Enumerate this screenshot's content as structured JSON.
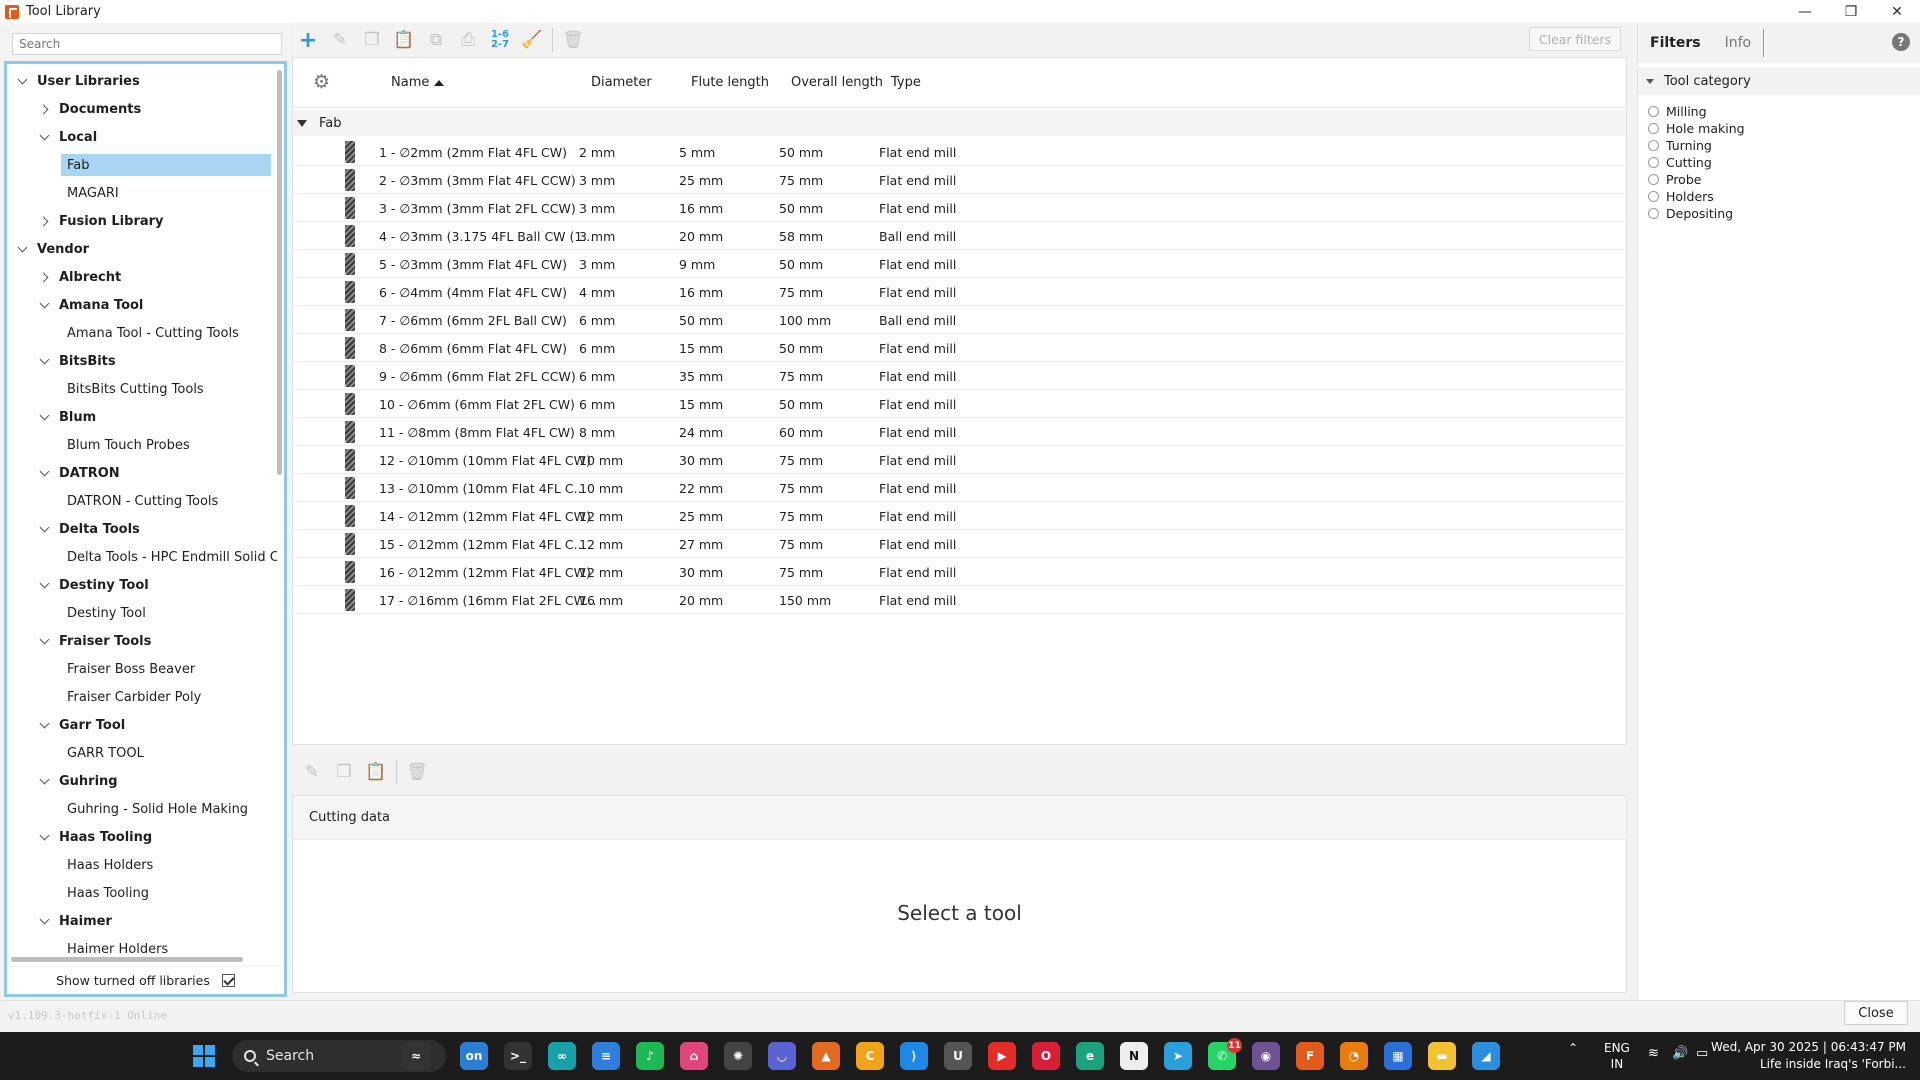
{
  "window": {
    "title": "Tool Library"
  },
  "left": {
    "search_placeholder": "Search",
    "show_turned_off_label": "Show turned off libraries",
    "show_turned_off_checked": true,
    "tree": [
      {
        "label": "User Libraries",
        "level": 0,
        "expand": "down",
        "bold": true
      },
      {
        "label": "Documents",
        "level": 1,
        "expand": "right",
        "bold": true
      },
      {
        "label": "Local",
        "level": 1,
        "expand": "down",
        "bold": true
      },
      {
        "label": "Fab",
        "level": 2,
        "expand": "none",
        "bold": false,
        "selected": true
      },
      {
        "label": "MAGARI",
        "level": 2,
        "expand": "none",
        "bold": false
      },
      {
        "label": "Fusion Library",
        "level": 1,
        "expand": "right",
        "bold": true
      },
      {
        "label": "Vendor",
        "level": 0,
        "expand": "down",
        "bold": true
      },
      {
        "label": "Albrecht",
        "level": 1,
        "expand": "right",
        "bold": true
      },
      {
        "label": "Amana Tool",
        "level": 1,
        "expand": "down",
        "bold": true
      },
      {
        "label": "Amana Tool - Cutting Tools",
        "level": 2,
        "expand": "none",
        "bold": false
      },
      {
        "label": "BitsBits",
        "level": 1,
        "expand": "down",
        "bold": true
      },
      {
        "label": "BitsBits Cutting Tools",
        "level": 2,
        "expand": "none",
        "bold": false
      },
      {
        "label": "Blum",
        "level": 1,
        "expand": "down",
        "bold": true
      },
      {
        "label": "Blum Touch Probes",
        "level": 2,
        "expand": "none",
        "bold": false
      },
      {
        "label": "DATRON",
        "level": 1,
        "expand": "down",
        "bold": true
      },
      {
        "label": "DATRON - Cutting Tools",
        "level": 2,
        "expand": "none",
        "bold": false
      },
      {
        "label": "Delta Tools",
        "level": 1,
        "expand": "down",
        "bold": true
      },
      {
        "label": "Delta Tools - HPC Endmill Solid Carb",
        "level": 2,
        "expand": "none",
        "bold": false
      },
      {
        "label": "Destiny Tool",
        "level": 1,
        "expand": "down",
        "bold": true
      },
      {
        "label": "Destiny Tool",
        "level": 2,
        "expand": "none",
        "bold": false
      },
      {
        "label": "Fraiser Tools",
        "level": 1,
        "expand": "down",
        "bold": true
      },
      {
        "label": "Fraiser Boss Beaver",
        "level": 2,
        "expand": "none",
        "bold": false
      },
      {
        "label": "Fraiser Carbider Poly",
        "level": 2,
        "expand": "none",
        "bold": false
      },
      {
        "label": "Garr Tool",
        "level": 1,
        "expand": "down",
        "bold": true
      },
      {
        "label": "GARR TOOL",
        "level": 2,
        "expand": "none",
        "bold": false
      },
      {
        "label": "Guhring",
        "level": 1,
        "expand": "down",
        "bold": true
      },
      {
        "label": "Guhring - Solid Hole Making",
        "level": 2,
        "expand": "none",
        "bold": false
      },
      {
        "label": "Haas Tooling",
        "level": 1,
        "expand": "down",
        "bold": true
      },
      {
        "label": "Haas Holders",
        "level": 2,
        "expand": "none",
        "bold": false
      },
      {
        "label": "Haas Tooling",
        "level": 2,
        "expand": "none",
        "bold": false
      },
      {
        "label": "Haimer",
        "level": 1,
        "expand": "down",
        "bold": true
      },
      {
        "label": "Haimer Holders",
        "level": 2,
        "expand": "none",
        "bold": false
      }
    ]
  },
  "toolbar": {
    "clear_filters": "Clear filters",
    "renumber_label": "1-6 2-7"
  },
  "table": {
    "columns": [
      "Name",
      "Diameter",
      "Flute length",
      "Overall length",
      "Type"
    ],
    "group": "Fab",
    "rows": [
      [
        "1 - ∅2mm (2mm Flat 4FL CW)",
        "2 mm",
        "5 mm",
        "50 mm",
        "Flat end mill"
      ],
      [
        "2 - ∅3mm (3mm Flat 4FL CCW)",
        "3 mm",
        "25 mm",
        "75 mm",
        "Flat end mill"
      ],
      [
        "3 - ∅3mm (3mm Flat 2FL CCW)",
        "3 mm",
        "16 mm",
        "50 mm",
        "Flat end mill"
      ],
      [
        "4 - ∅3mm (3.175 4FL Ball CW (1...",
        "3 mm",
        "20 mm",
        "58 mm",
        "Ball end mill"
      ],
      [
        "5 - ∅3mm (3mm Flat 4FL CW)",
        "3 mm",
        "9 mm",
        "50 mm",
        "Flat end mill"
      ],
      [
        "6 - ∅4mm (4mm Flat 4FL CW)",
        "4 mm",
        "16 mm",
        "75 mm",
        "Flat end mill"
      ],
      [
        "7 - ∅6mm (6mm 2FL Ball CW)",
        "6 mm",
        "50 mm",
        "100 mm",
        "Ball end mill"
      ],
      [
        "8 - ∅6mm (6mm Flat 4FL CW)",
        "6 mm",
        "15 mm",
        "50 mm",
        "Flat end mill"
      ],
      [
        "9 - ∅6mm (6mm Flat 2FL CCW)",
        "6 mm",
        "35 mm",
        "75 mm",
        "Flat end mill"
      ],
      [
        "10 - ∅6mm (6mm Flat 2FL CW)",
        "6 mm",
        "15 mm",
        "50 mm",
        "Flat end mill"
      ],
      [
        "11 - ∅8mm (8mm Flat 4FL CW)",
        "8 mm",
        "24 mm",
        "60 mm",
        "Flat end mill"
      ],
      [
        "12 - ∅10mm (10mm Flat 4FL CW)",
        "10 mm",
        "30 mm",
        "75 mm",
        "Flat end mill"
      ],
      [
        "13 - ∅10mm (10mm Flat 4FL C...",
        "10 mm",
        "22 mm",
        "75 mm",
        "Flat end mill"
      ],
      [
        "14 - ∅12mm (12mm Flat 4FL CW)",
        "12 mm",
        "25 mm",
        "75 mm",
        "Flat end mill"
      ],
      [
        "15 - ∅12mm (12mm Flat 4FL C...",
        "12 mm",
        "27 mm",
        "75 mm",
        "Flat end mill"
      ],
      [
        "16 - ∅12mm (12mm Flat 4FL CW)",
        "12 mm",
        "30 mm",
        "75 mm",
        "Flat end mill"
      ],
      [
        "17 - ∅16mm (16mm Flat 2FL CW...",
        "16 mm",
        "20 mm",
        "150 mm",
        "Flat end mill"
      ]
    ]
  },
  "bottom": {
    "tab_label": "Cutting data",
    "empty_message": "Select a tool"
  },
  "right": {
    "tabs": [
      "Filters",
      "Info"
    ],
    "category_header": "Tool category",
    "categories": [
      "Milling",
      "Hole making",
      "Turning",
      "Cutting",
      "Probe",
      "Holders",
      "Depositing"
    ]
  },
  "status": {
    "version": "v1.109.3-hotfix-1 Online",
    "close_label": "Close"
  },
  "taskbar": {
    "search_label": "Search",
    "lang_top": "ENG",
    "lang_bottom": "IN",
    "clock_line1": "Wed, Apr 30 2025 | 06:43:47 PM",
    "clock_line2": "Life inside Iraq's 'Forbi...",
    "whatsapp_badge": "11"
  },
  "colors": {
    "selection": "#a8d5f1",
    "accent": "#2e9bd6",
    "tree_border": "#8fc9e6"
  }
}
